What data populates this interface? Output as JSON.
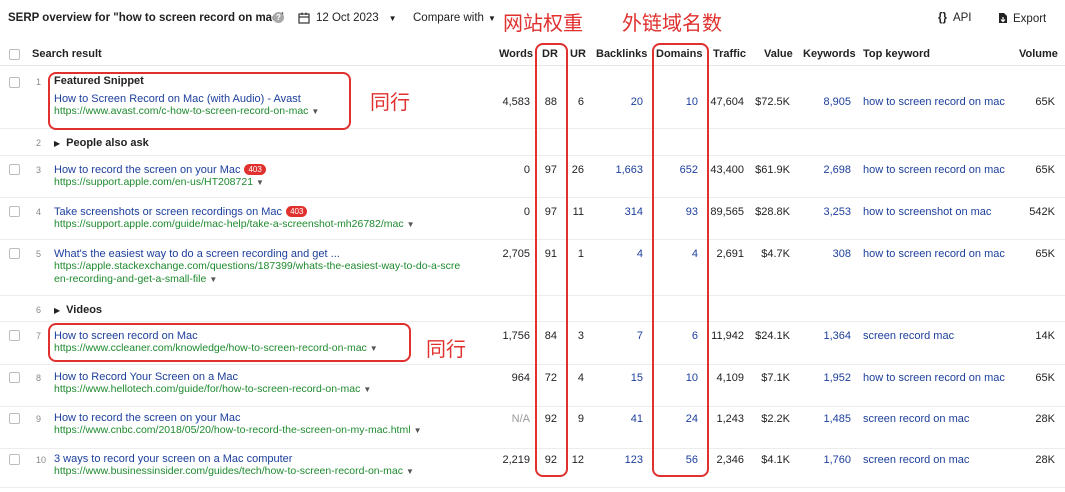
{
  "header": {
    "title": "SERP overview for \"how to screen record on mac\"",
    "help_icon": "?",
    "date": "12 Oct 2023",
    "compare_label": "Compare with",
    "api_label": "API",
    "api_icon": "{}",
    "export_label": "Export"
  },
  "annotations": {
    "dr_note": "网站权重",
    "domains_note": "外链域名数",
    "peer1": "同行",
    "peer2": "同行"
  },
  "columns": [
    "Search result",
    "Words",
    "DR",
    "UR",
    "Backlinks",
    "Domains",
    "Traffic",
    "Value",
    "Keywords",
    "Top keyword",
    "Volume"
  ],
  "rows": [
    {
      "num": "1",
      "label": "Featured Snippet",
      "title": "How to Screen Record on Mac (with Audio) - Avast",
      "url": "https://www.avast.com/c-how-to-screen-record-on-mac",
      "words": "4,583",
      "dr": "88",
      "ur": "6",
      "backlinks": "20",
      "domains": "10",
      "traffic": "47,604",
      "value": "$72.5K",
      "keywords": "8,905",
      "top_keyword": "how to screen record on mac",
      "volume": "65K"
    },
    {
      "num": "2",
      "section": "People also ask"
    },
    {
      "num": "3",
      "title": "How to record the screen on your Mac",
      "badge": "403",
      "url": "https://support.apple.com/en-us/HT208721",
      "words": "0",
      "dr": "97",
      "ur": "26",
      "backlinks": "1,663",
      "domains": "652",
      "traffic": "43,400",
      "value": "$61.9K",
      "keywords": "2,698",
      "top_keyword": "how to screen record on mac",
      "volume": "65K"
    },
    {
      "num": "4",
      "title": "Take screenshots or screen recordings on Mac",
      "badge": "403",
      "url": "https://support.apple.com/guide/mac-help/take-a-screenshot-mh26782/mac",
      "words": "0",
      "dr": "97",
      "ur": "11",
      "backlinks": "314",
      "domains": "93",
      "traffic": "89,565",
      "value": "$28.8K",
      "keywords": "3,253",
      "top_keyword": "how to screenshot on mac",
      "volume": "542K"
    },
    {
      "num": "5",
      "title": "What's the easiest way to do a screen recording and get ...",
      "url": "https://apple.stackexchange.com/questions/187399/whats-the-easiest-way-to-do-a-scre",
      "url2": "en-recording-and-get-a-small-file",
      "words": "2,705",
      "dr": "91",
      "ur": "1",
      "backlinks": "4",
      "domains": "4",
      "traffic": "2,691",
      "value": "$4.7K",
      "keywords": "308",
      "top_keyword": "how to screen record on mac",
      "volume": "65K"
    },
    {
      "num": "6",
      "section": "Videos"
    },
    {
      "num": "7",
      "title": "How to screen record on Mac",
      "url": "https://www.ccleaner.com/knowledge/how-to-screen-record-on-mac",
      "words": "1,756",
      "dr": "84",
      "ur": "3",
      "backlinks": "7",
      "domains": "6",
      "traffic": "11,942",
      "value": "$24.1K",
      "keywords": "1,364",
      "top_keyword": "screen record mac",
      "volume": "14K"
    },
    {
      "num": "8",
      "title": "How to Record Your Screen on a Mac",
      "url": "https://www.hellotech.com/guide/for/how-to-screen-record-on-mac",
      "words": "964",
      "dr": "72",
      "ur": "4",
      "backlinks": "15",
      "domains": "10",
      "traffic": "4,109",
      "value": "$7.1K",
      "keywords": "1,952",
      "top_keyword": "how to screen record on mac",
      "volume": "65K"
    },
    {
      "num": "9",
      "title": "How to record the screen on your Mac",
      "url": "https://www.cnbc.com/2018/05/20/how-to-record-the-screen-on-my-mac.html",
      "words": "N/A",
      "dr": "92",
      "ur": "9",
      "backlinks": "41",
      "domains": "24",
      "traffic": "1,243",
      "value": "$2.2K",
      "keywords": "1,485",
      "top_keyword": "screen record on mac",
      "volume": "28K"
    },
    {
      "num": "10",
      "title": "3 ways to record your screen on a Mac computer",
      "url": "https://www.businessinsider.com/guides/tech/how-to-screen-record-on-mac",
      "words": "2,219",
      "dr": "92",
      "ur": "12",
      "backlinks": "123",
      "domains": "56",
      "traffic": "2,346",
      "value": "$4.1K",
      "keywords": "1,760",
      "top_keyword": "screen record on mac",
      "volume": "28K"
    }
  ]
}
